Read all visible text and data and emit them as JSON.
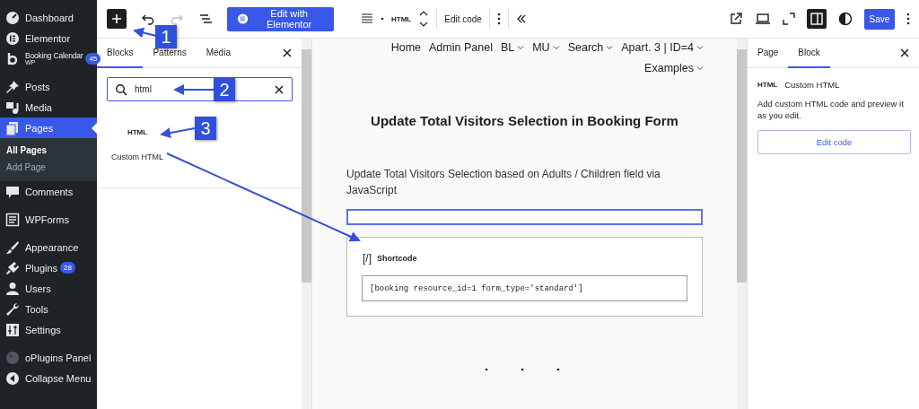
{
  "sidebar": {
    "items": [
      {
        "kind": "item",
        "label": "Dashboard",
        "selected": false
      },
      {
        "kind": "item",
        "label": "Elementor",
        "selected": false
      },
      {
        "kind": "item",
        "label": "Booking Calendar",
        "sublabel": "WP",
        "badge": "45",
        "selected": false
      },
      {
        "kind": "gap"
      },
      {
        "kind": "item",
        "label": "Posts",
        "selected": false
      },
      {
        "kind": "item",
        "label": "Media",
        "selected": false
      },
      {
        "kind": "item",
        "label": "Pages",
        "selected": true,
        "children": [
          {
            "label": "All Pages",
            "selected": true
          },
          {
            "label": "Add Page",
            "selected": false
          }
        ]
      },
      {
        "kind": "item",
        "label": "Comments",
        "selected": false
      },
      {
        "kind": "gap"
      },
      {
        "kind": "item",
        "label": "WPForms",
        "selected": false
      },
      {
        "kind": "gap"
      },
      {
        "kind": "item",
        "label": "Appearance",
        "selected": false
      },
      {
        "kind": "item",
        "label": "Plugins",
        "badge": "28",
        "selected": false
      },
      {
        "kind": "item",
        "label": "Users",
        "selected": false
      },
      {
        "kind": "item",
        "label": "Tools",
        "selected": false
      },
      {
        "kind": "item",
        "label": "Settings",
        "selected": false
      },
      {
        "kind": "gap"
      },
      {
        "kind": "item",
        "label": "oPlugins Panel",
        "selected": false
      },
      {
        "kind": "item",
        "label": "Collapse Menu",
        "selected": false
      }
    ]
  },
  "toolbar": {
    "elementor_button": "Edit with Elementor",
    "block_label": "HTML",
    "edit_code": "Edit code",
    "save": "Save"
  },
  "inserter": {
    "tabs": [
      {
        "label": "Blocks",
        "selected": true
      },
      {
        "label": "Patterns",
        "selected": false
      },
      {
        "label": "Media",
        "selected": false
      }
    ],
    "search": {
      "value": "html"
    },
    "results": [
      {
        "icon_text": "HTML",
        "label": "Custom HTML"
      }
    ]
  },
  "canvas": {
    "nav": [
      {
        "label": "Home",
        "dropdown": false
      },
      {
        "label": "Admin Panel",
        "dropdown": false
      },
      {
        "label": "BL",
        "dropdown": true
      },
      {
        "label": "MU",
        "dropdown": true
      },
      {
        "label": "Search",
        "dropdown": true
      },
      {
        "label": "Apart. 3 | ID=4",
        "dropdown": true
      },
      {
        "label": "Examples",
        "dropdown": true
      }
    ],
    "title": "Update Total Visitors Selection in Booking Form",
    "paragraph": "Update Total Visitors Selection based on Adults / Children field via JavaScript",
    "shortcode": {
      "icon_text": "[/]",
      "label": "Shortcode",
      "value": "[booking resource_id=1 form_type='standard']"
    }
  },
  "settings": {
    "tabs": [
      {
        "label": "Page",
        "selected": false
      },
      {
        "label": "Block",
        "selected": true
      }
    ],
    "block": {
      "icon_text": "HTML",
      "name": "Custom HTML",
      "description": "Add custom HTML code and preview it as you edit.",
      "button": "Edit code"
    }
  },
  "annotations": [
    {
      "label": "1"
    },
    {
      "label": "2"
    },
    {
      "label": "3"
    }
  ]
}
